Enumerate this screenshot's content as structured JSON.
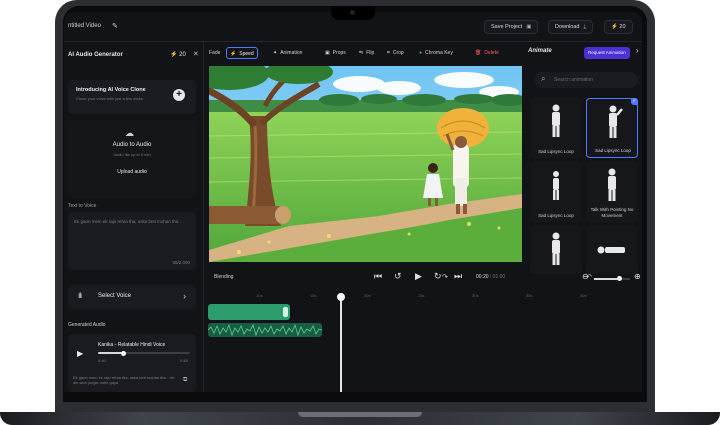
{
  "topbar": {
    "project_title": "ntitled Video",
    "save_label": "Save Project",
    "download_label": "Download",
    "credits": "20"
  },
  "left_panel": {
    "title": "AI Audio Generator",
    "credits": "20",
    "voice_clone": {
      "title": "Introducing AI Voice Clone",
      "subtitle": "Clone your voice with just a few clicks"
    },
    "audio_to_audio": {
      "title": "Audio to Audio",
      "subtitle": "Audio file up to 5 min",
      "upload_label": "Upload audio"
    },
    "text_label": "Text to Voice",
    "text_value": "Ek gaon mein ek rajo rehta tha, uska beti mohan tha...",
    "char_count": "55/2,000",
    "select_voice_label": "Select Voice",
    "generated_label": "Generated Audio",
    "generated": {
      "title": "Kanika - Relatable Hindi Voice",
      "time_current": "0:40",
      "time_total": "0:45",
      "progress": 0.28,
      "description": "Ek gaon mein ek rajo rehta tha, uska beti mohan tha... ek din woh jungle mein gaya"
    }
  },
  "tools": {
    "items": [
      {
        "label": "Fade",
        "icon": ""
      },
      {
        "label": "Speed",
        "icon": "⚡",
        "active": true
      },
      {
        "label": "Animation",
        "icon": "✦"
      },
      {
        "label": "Props",
        "icon": "▣"
      },
      {
        "label": "Flip",
        "icon": "⇋"
      },
      {
        "label": "Crop",
        "icon": "⌗"
      },
      {
        "label": "Chroma Key",
        "icon": "●"
      },
      {
        "label": "Delete",
        "icon": "🗑"
      }
    ],
    "animate_label": "Animate",
    "request_label": "Request Animation"
  },
  "right_panel": {
    "search_placeholder": "Search animation",
    "animations": [
      {
        "label": "Sad Lipsync Loop"
      },
      {
        "label": "Sad Lipsync Loop",
        "selected": true
      },
      {
        "label": "Sad Lipsync Loop"
      },
      {
        "label": "Sad Lipsync Loop"
      },
      {
        "label": "Talk With Pointing No Movement"
      },
      {
        "label": ""
      },
      {
        "label": ""
      }
    ]
  },
  "timeline": {
    "blend_label": "Blending",
    "time_current": "00:20",
    "time_total": "/ 01:00",
    "zoom": 0.72,
    "ticks": [
      "10s",
      "15s",
      "20s",
      "25s",
      "30s",
      "35s",
      "40s"
    ]
  }
}
